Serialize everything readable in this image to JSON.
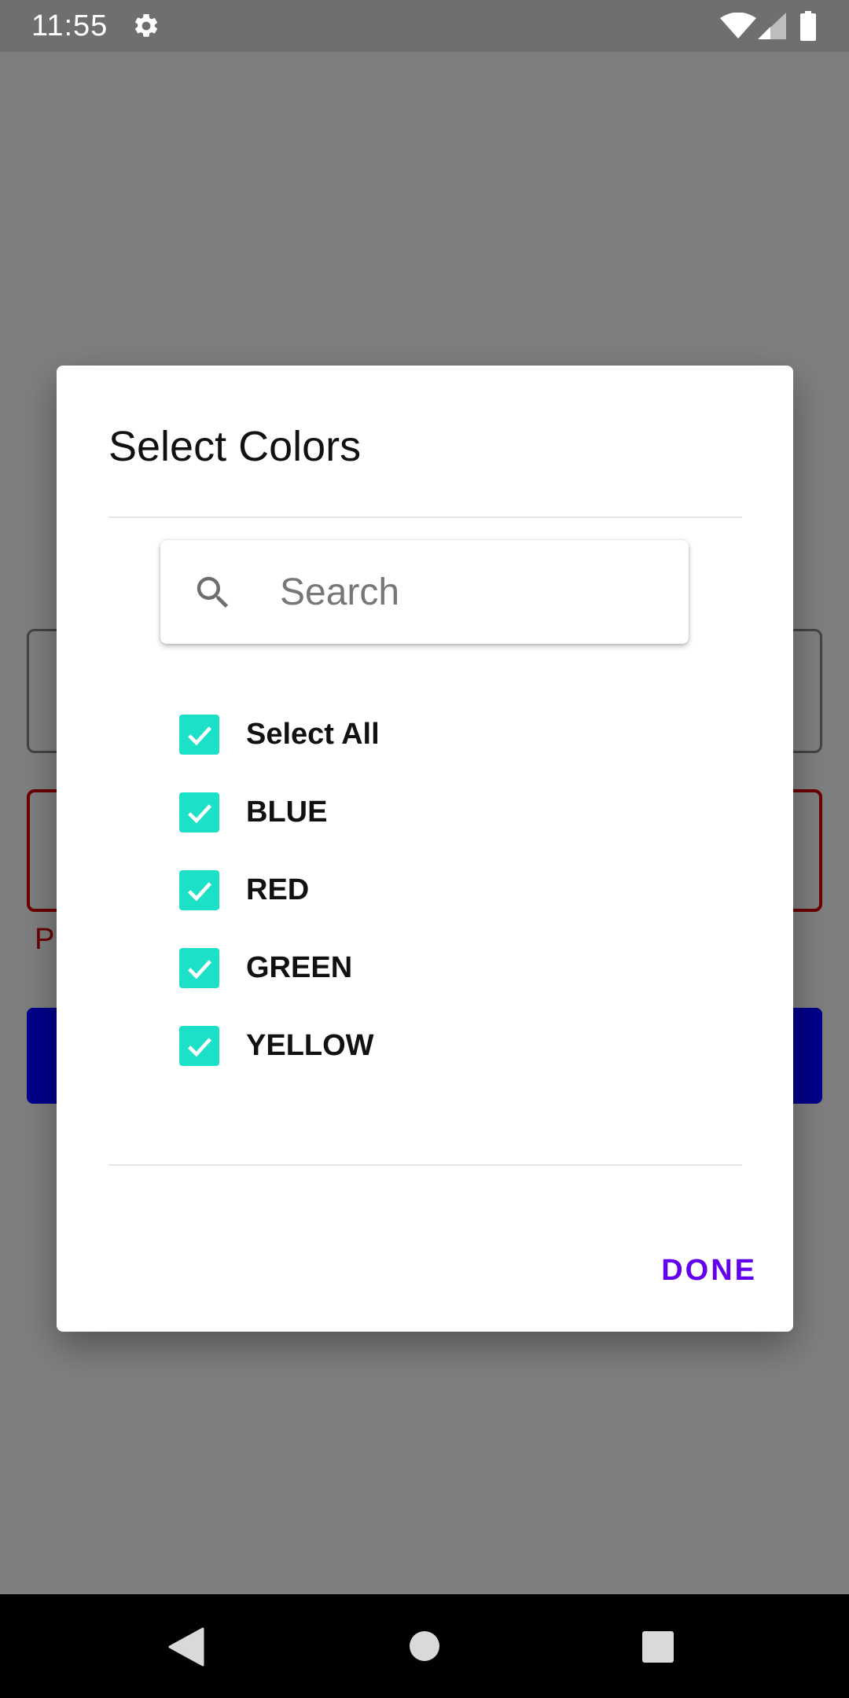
{
  "status_bar": {
    "time": "11:55",
    "icons": [
      "gear-icon",
      "wifi-icon",
      "signal-icon",
      "battery-icon"
    ]
  },
  "background": {
    "error_text": "P"
  },
  "dialog": {
    "title": "Select Colors",
    "search": {
      "placeholder": "Search",
      "value": ""
    },
    "options": [
      {
        "label": "Select All",
        "checked": true
      },
      {
        "label": "BLUE",
        "checked": true
      },
      {
        "label": "RED",
        "checked": true
      },
      {
        "label": "GREEN",
        "checked": true
      },
      {
        "label": "YELLOW",
        "checked": true
      }
    ],
    "done_label": "DONE"
  },
  "colors": {
    "checkbox_accent": "#1de0c8",
    "done_button": "#6200ee",
    "scrim": "#7f7f7f"
  },
  "nav_bar": {
    "icons": [
      "back-icon",
      "home-icon",
      "recents-icon"
    ]
  }
}
